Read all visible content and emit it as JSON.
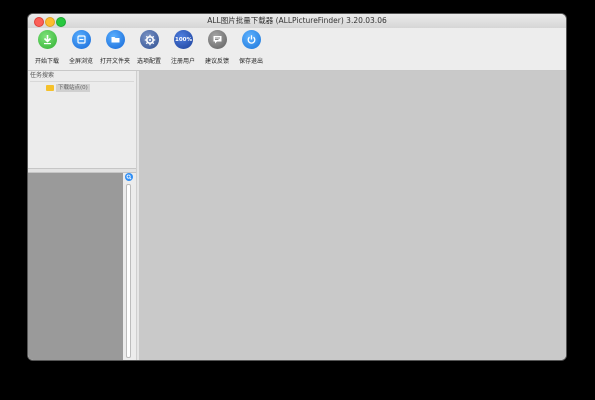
{
  "window": {
    "title": "ALL图片批量下载器 (ALLPictureFinder) 3.20.03.06"
  },
  "toolbar": {
    "buttons": [
      {
        "label": "开始下载",
        "icon": "download-icon"
      },
      {
        "label": "全屏浏览",
        "icon": "fullscreen-icon"
      },
      {
        "label": "打开文件夹",
        "icon": "folder-icon"
      },
      {
        "label": "选项配置",
        "icon": "gear-icon"
      },
      {
        "label": "注册用户",
        "icon": "register-100-icon",
        "icon_text": "100%"
      },
      {
        "label": "建议反馈",
        "icon": "feedback-icon"
      },
      {
        "label": "保存退出",
        "icon": "power-icon"
      }
    ]
  },
  "left_panel": {
    "header": "任务搜索",
    "tree_items": [
      {
        "label": "下载站点(0)"
      }
    ]
  },
  "colors": {
    "accent_blue": "#2f8ef5",
    "main_area": "#c9c9c9",
    "preview": "#9a9a9a"
  }
}
